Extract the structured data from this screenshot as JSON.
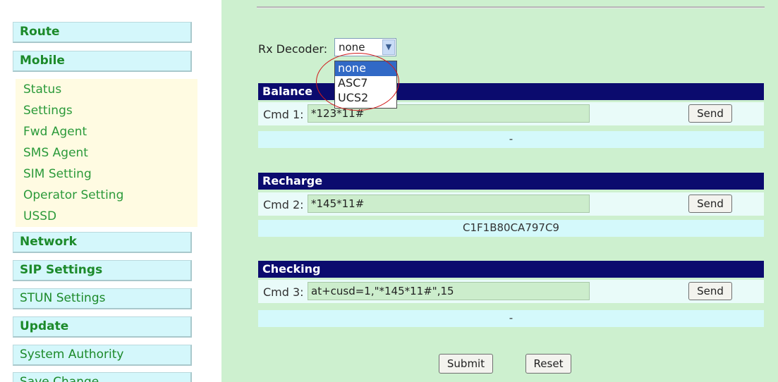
{
  "sidebar": {
    "main_items": [
      {
        "label": "Route"
      },
      {
        "label": "Mobile"
      },
      {
        "label": "Network"
      },
      {
        "label": "SIP Settings"
      },
      {
        "label": "STUN Settings"
      },
      {
        "label": "Update"
      },
      {
        "label": "System Authority"
      },
      {
        "label": "Save Change"
      }
    ],
    "mobile_sub_items": [
      {
        "label": "Status"
      },
      {
        "label": "Settings"
      },
      {
        "label": "Fwd Agent"
      },
      {
        "label": "SMS Agent"
      },
      {
        "label": "SIM Setting"
      },
      {
        "label": "Operator Setting"
      },
      {
        "label": "USSD"
      }
    ]
  },
  "decoder": {
    "label": "Rx Decoder:",
    "selected": "none",
    "options": [
      "none",
      "ASC7",
      "UCS2"
    ]
  },
  "sections": [
    {
      "title": "Balance",
      "cmd_label": "Cmd 1:",
      "cmd_value": "*123*11#",
      "send_label": "Send",
      "result": "-"
    },
    {
      "title": "Recharge",
      "cmd_label": "Cmd 2:",
      "cmd_value": "*145*11#",
      "send_label": "Send",
      "result": "C1F1B80CA797C9"
    },
    {
      "title": "Checking",
      "cmd_label": "Cmd 3:",
      "cmd_value": "at+cusd=1,\"*145*11#\",15",
      "send_label": "Send",
      "result": "-"
    }
  ],
  "form": {
    "submit_label": "Submit",
    "reset_label": "Reset"
  },
  "colors": {
    "header_bg": "#0b0b6e",
    "main_bg": "#cdf0cf",
    "nav_text": "#1c8a2a",
    "dropdown_selected": "#3169c6",
    "annotation_circle": "#d11b1b"
  }
}
